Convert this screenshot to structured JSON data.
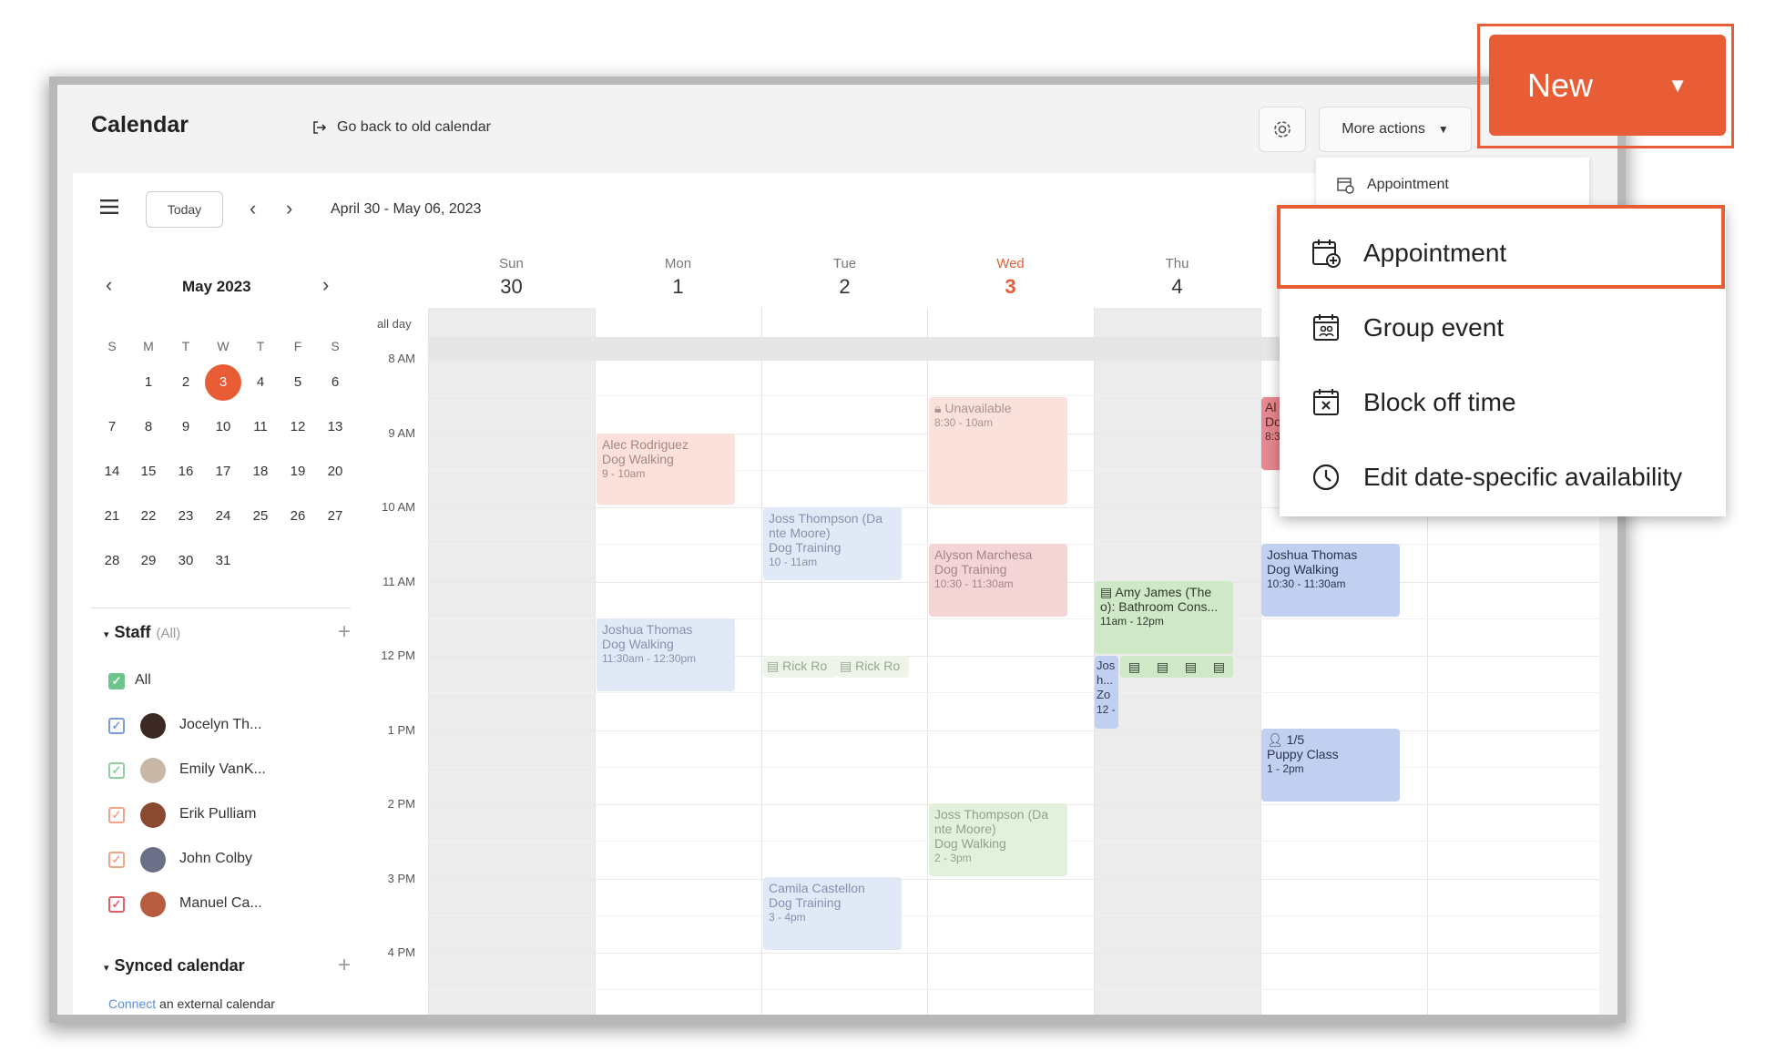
{
  "header": {
    "title": "Calendar",
    "go_back": "Go back to old calendar",
    "more_actions": "More actions",
    "new_label": "New"
  },
  "toolbar": {
    "today": "Today",
    "date_range": "April 30 - May 06, 2023"
  },
  "mini_calendar": {
    "title": "May 2023",
    "weekdays": [
      "S",
      "M",
      "T",
      "W",
      "T",
      "F",
      "S"
    ],
    "weeks": [
      [
        "",
        "1",
        "2",
        "3",
        "4",
        "5",
        "6"
      ],
      [
        "7",
        "8",
        "9",
        "10",
        "11",
        "12",
        "13"
      ],
      [
        "14",
        "15",
        "16",
        "17",
        "18",
        "19",
        "20"
      ],
      [
        "21",
        "22",
        "23",
        "24",
        "25",
        "26",
        "27"
      ],
      [
        "28",
        "29",
        "30",
        "31",
        "",
        "",
        ""
      ]
    ],
    "selected": "3"
  },
  "staff": {
    "title": "Staff",
    "filter": "(All)",
    "items": [
      {
        "label": "All",
        "color": "#6cc58a"
      },
      {
        "label": "Jocelyn Th...",
        "color": "#7b9be0"
      },
      {
        "label": "Emily VanK...",
        "color": "#8fd19e"
      },
      {
        "label": "Erik Pulliam",
        "color": "#f2a488"
      },
      {
        "label": "John Colby",
        "color": "#f2a488"
      },
      {
        "label": "Manuel Ca...",
        "color": "#e0606a"
      }
    ]
  },
  "synced": {
    "title": "Synced calendar",
    "connect": "Connect",
    "connect_rest": " an external calendar"
  },
  "days": [
    {
      "name": "Sun",
      "num": "30"
    },
    {
      "name": "Mon",
      "num": "1"
    },
    {
      "name": "Tue",
      "num": "2"
    },
    {
      "name": "Wed",
      "num": "3"
    },
    {
      "name": "Thu",
      "num": "4"
    }
  ],
  "all_day": "all day",
  "times": [
    "8 AM",
    "9 AM",
    "10 AM",
    "11 AM",
    "12 PM",
    "1 PM",
    "2 PM",
    "3 PM",
    "4 PM"
  ],
  "events": {
    "alec": {
      "name": "Alec Rodriguez",
      "service": "Dog Walking",
      "time": "9 - 10am"
    },
    "joss1": {
      "name": "Joss Thompson (Da nte Moore)",
      "service": "Dog Training",
      "time": "10 - 11am"
    },
    "unavail": {
      "name": "Unavailable",
      "time": "8:30 - 10am"
    },
    "alyson": {
      "name": "Alyson Marchesa",
      "service": "Dog Training",
      "time": "10:30 - 11:30am"
    },
    "joshua_mon": {
      "name": "Joshua Thomas",
      "service": "Dog Walking",
      "time": "11:30am - 12:30pm"
    },
    "rick1": "Rick Ro",
    "rick2": "Rick Ro",
    "amy": {
      "name": "Amy James (The o): Bathroom Cons...",
      "time": "11am - 12pm"
    },
    "jos_small": {
      "l1": "Jos",
      "l2": "h...",
      "l3": "Zo",
      "l4": "12 -"
    },
    "joshua_fri": {
      "name": "Joshua Thomas",
      "service": "Dog Walking",
      "time": "10:30 - 11:30am"
    },
    "puppy": {
      "count": "1/5",
      "name": "Puppy Class",
      "time": "1 - 2pm"
    },
    "joss2": {
      "name": "Joss Thompson (Da nte Moore)",
      "service": "Dog Walking",
      "time": "2 - 3pm"
    },
    "camila": {
      "name": "Camila Castellon",
      "service": "Dog Training",
      "time": "3 - 4pm"
    },
    "partial": {
      "l1": "Al",
      "l2": "Do",
      "l3": "8:3"
    }
  },
  "small_dropdown": {
    "appointment": "Appointment"
  },
  "dropdown": {
    "items": [
      "Appointment",
      "Group event",
      "Block off time",
      "Edit date-specific availability"
    ]
  },
  "colors": {
    "accent": "#e85d36"
  }
}
